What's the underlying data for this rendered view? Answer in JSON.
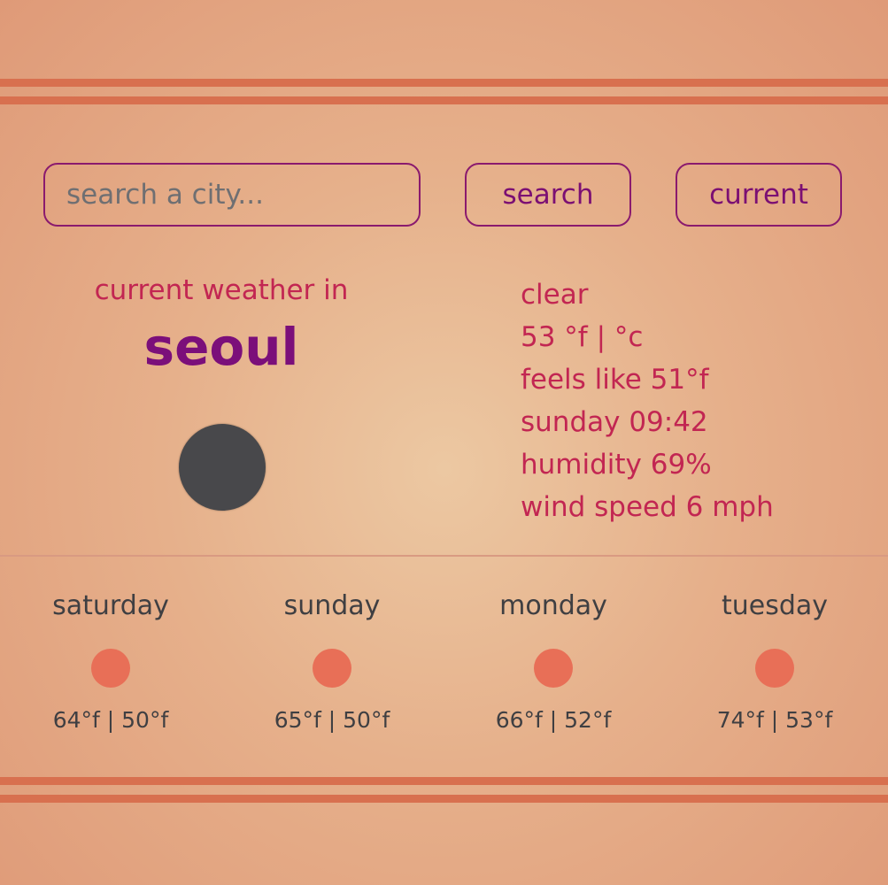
{
  "search": {
    "placeholder": "search a city...",
    "search_label": "search",
    "current_label": "current"
  },
  "current": {
    "label": "current weather in",
    "city": "seoul",
    "icon": "weather-icon",
    "description": "clear",
    "temperature": "53 °f | °c",
    "feels_like": "feels like 51°f",
    "datetime": "sunday 09:42",
    "humidity": "humidity 69%",
    "wind": "wind speed 6 mph"
  },
  "forecast": [
    {
      "day": "saturday",
      "temps": "64°f | 50°f",
      "icon": "sun-icon"
    },
    {
      "day": "sunday",
      "temps": "65°f | 50°f",
      "icon": "sun-icon"
    },
    {
      "day": "monday",
      "temps": "66°f | 52°f",
      "icon": "sun-icon"
    },
    {
      "day": "tuesday",
      "temps": "74°f | 53°f",
      "icon": "sun-icon"
    }
  ],
  "colors": {
    "stripe": "#d8704f",
    "accent_purple": "#7b0f7a",
    "text_red": "#c22652",
    "forecast_icon": "#e86f57",
    "current_icon": "#48484b"
  }
}
